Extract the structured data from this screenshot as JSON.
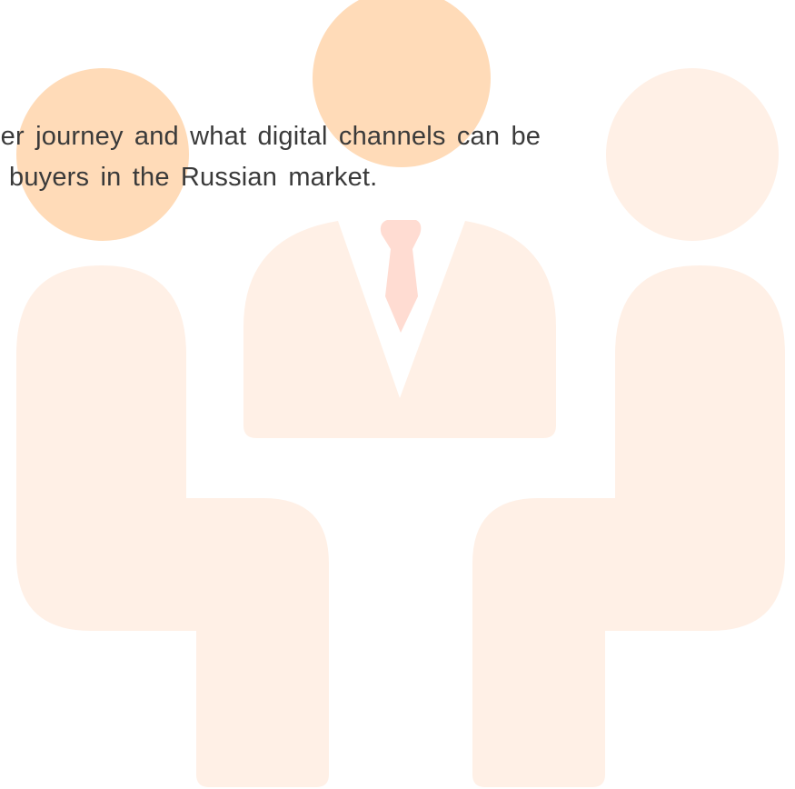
{
  "colors": {
    "primary_figure": "#FFDBB8",
    "secondary_figure": "#FFF0E6",
    "tie": "#FFDCD2",
    "text": "#3A3A3A",
    "background": "#FFFFFF"
  },
  "icons": [
    "business-meeting-icon",
    "person-icon",
    "necktie-icon"
  ],
  "caption": {
    "line1": "omer journey and what digital channels can be",
    "line2": "buyers in the Russian market."
  }
}
